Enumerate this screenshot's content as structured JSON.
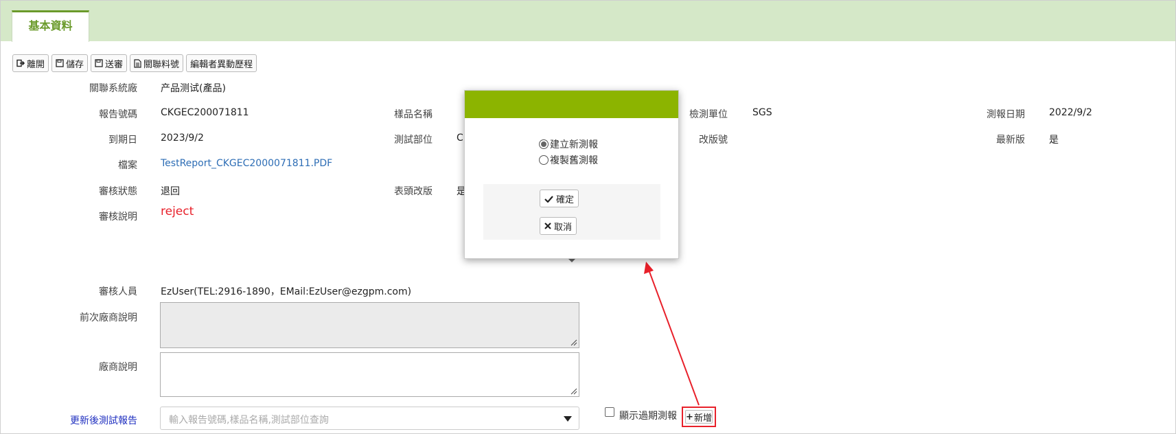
{
  "tabs": [
    {
      "label": "基本資料",
      "active": true
    }
  ],
  "toolbar": {
    "leave": "離開",
    "save": "儲存",
    "submit": "送審",
    "link_part": "關聯料號",
    "editor_history": "編輯者異動歷程"
  },
  "form": {
    "related_factory": {
      "label": "關聯系統廠",
      "value": "产品测试(產品)"
    },
    "report_no": {
      "label": "報告號碼",
      "value": "CKGEC200071811"
    },
    "sample_name": {
      "label": "樣品名稱",
      "value": ""
    },
    "test_unit": {
      "label": "檢測單位",
      "value": "SGS"
    },
    "report_date": {
      "label": "測報日期",
      "value": "2022/9/2"
    },
    "expire_date": {
      "label": "到期日",
      "value": "2023/9/2"
    },
    "test_part": {
      "label": "測試部位",
      "value": "C"
    },
    "revision_no": {
      "label": "改版號",
      "value": ""
    },
    "latest_version": {
      "label": "最新版",
      "value": "是"
    },
    "file": {
      "label": "檔案",
      "value": "TestReport_CKGEC2000071811.PDF"
    },
    "review_status": {
      "label": "審核狀態",
      "value": "退回"
    },
    "header_revision": {
      "label": "表頭改版",
      "value": "是"
    },
    "review_note": {
      "label": "審核說明",
      "value": "reject"
    },
    "reviewer": {
      "label": "審核人員",
      "value": "EzUser(TEL:2916-1890，EMail:EzUser@ezgpm.com)"
    },
    "prev_vendor_note": {
      "label": "前次廠商說明",
      "value": ""
    },
    "vendor_note": {
      "label": "廠商說明",
      "value": ""
    },
    "updated_report": {
      "label": "更新後測試報告",
      "placeholder": "輸入報告號碼,樣品名稱,測試部位查詢"
    },
    "show_expired": {
      "label": "顯示過期測報",
      "checked": false
    },
    "add_button": "新增"
  },
  "dialog": {
    "options": [
      {
        "label": "建立新測報",
        "selected": true
      },
      {
        "label": "複製舊測報",
        "selected": false
      }
    ],
    "confirm": "確定",
    "cancel": "取消",
    "header_color": "#8cb400"
  },
  "colors": {
    "tab_bar": "#d5e8c8",
    "accent": "#6a9a2a",
    "alert": "#e8202a",
    "link": "#2d6db5"
  }
}
